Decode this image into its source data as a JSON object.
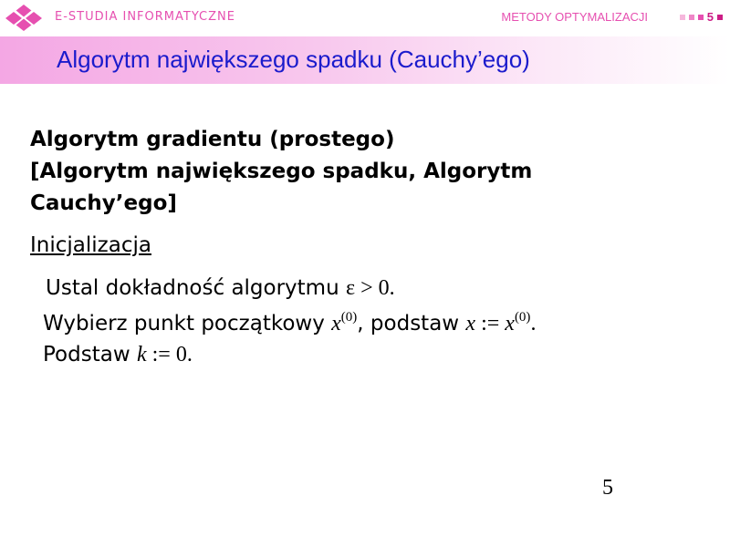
{
  "header": {
    "brand": "E-STUDIA INFORMATYCZNE",
    "course": "METODY OPTYMALIZACJI",
    "slide_number": "5",
    "accent_color": "#e64fb0",
    "logo_icon": "pink-diamond-grid-logo"
  },
  "title": "Algorytm największego spadku (Cauchy’ego)",
  "heading": {
    "line1": "Algorytm gradientu (prostego)",
    "line2": "[Algorytm największego spadku, Algorytm",
    "line3": "Cauchy’ego]"
  },
  "init_label": "Inicjalizacja",
  "steps": {
    "line1": {
      "text": "Ustal dokładność algorytmu ",
      "math_eps": "ε",
      "math_rest": " > 0."
    },
    "line2": {
      "text1": "Wybierz punkt początkowy ",
      "x1": "x",
      "sup1": "(0)",
      "text2": ", podstaw ",
      "x2": "x",
      "assign": " := ",
      "x3": "x",
      "sup2": "(0)",
      "end": "."
    },
    "line3": {
      "text": "Podstaw ",
      "k": "k",
      "rest": " := 0."
    }
  },
  "page_number": "5"
}
